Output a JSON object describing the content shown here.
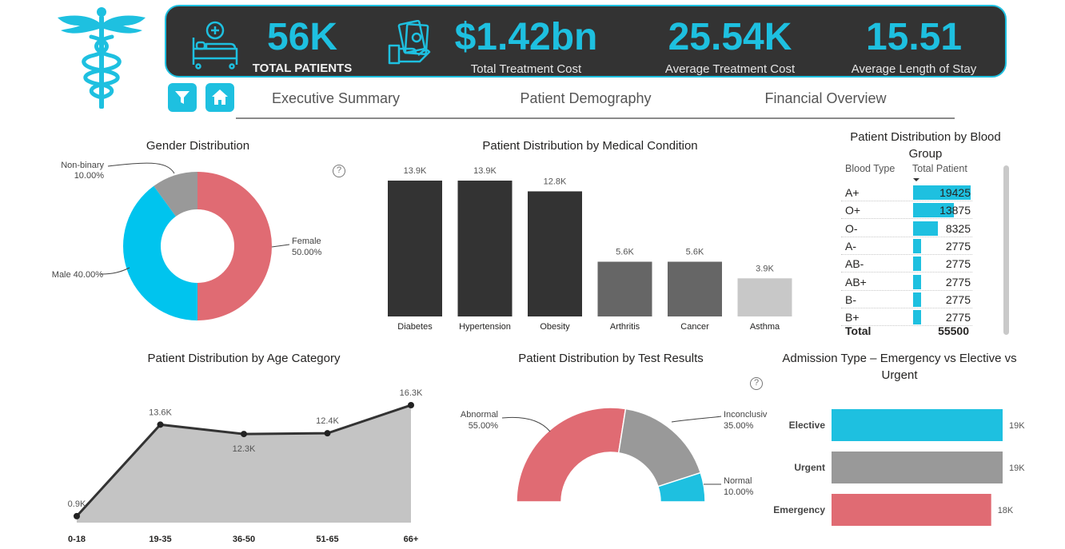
{
  "colors": {
    "accent": "#1ec0e0",
    "dark": "#333333",
    "red": "#e06b73",
    "gray": "#999999",
    "lightgray": "#c8c8c8",
    "midgray": "#666666"
  },
  "logo_icon": "caduceus-icon",
  "kpis": [
    {
      "value": "56K",
      "label": "TOTAL PATIENTS",
      "icon": "hospital-bed-icon"
    },
    {
      "value": "$1.42bn",
      "label": "Total Treatment Cost",
      "icon": "money-hand-icon"
    },
    {
      "value": "25.54K",
      "label": "Average Treatment Cost"
    },
    {
      "value": "15.51",
      "label": "Average Length of Stay"
    }
  ],
  "nav": {
    "filter_icon": "filter-icon",
    "home_icon": "home-icon",
    "tabs": [
      "Executive Summary",
      "Patient Demography",
      "Financial Overview"
    ]
  },
  "chart_data": [
    {
      "id": "gender",
      "type": "pie",
      "title": "Gender Distribution",
      "slices": [
        {
          "label": "Female",
          "value": 50.0,
          "display": "50.00%",
          "color": "#e06b73"
        },
        {
          "label": "Male",
          "value": 40.0,
          "display": "Male 40.00%",
          "color": "#00c4ee"
        },
        {
          "label": "Non-binary",
          "value": 10.0,
          "display": "10.00%",
          "color": "#999999"
        }
      ]
    },
    {
      "id": "condition",
      "type": "bar",
      "title": "Patient Distribution by Medical Condition",
      "categories": [
        "Diabetes",
        "Hypertension",
        "Obesity",
        "Arthritis",
        "Cancer",
        "Asthma"
      ],
      "values": [
        13.9,
        13.9,
        12.8,
        5.6,
        5.6,
        3.9
      ],
      "labels": [
        "13.9K",
        "13.9K",
        "12.8K",
        "5.6K",
        "5.6K",
        "3.9K"
      ],
      "colors": [
        "#333333",
        "#333333",
        "#333333",
        "#666666",
        "#666666",
        "#c8c8c8"
      ],
      "ylim": [
        0,
        13.9
      ]
    },
    {
      "id": "blood",
      "type": "table",
      "title": "Patient Distribution by Blood Group",
      "columns": [
        "Blood Type",
        "Total Patient"
      ],
      "rows": [
        {
          "type": "A+",
          "value": 19425
        },
        {
          "type": "O+",
          "value": 13875
        },
        {
          "type": "O-",
          "value": 8325
        },
        {
          "type": "A-",
          "value": 2775
        },
        {
          "type": "AB-",
          "value": 2775
        },
        {
          "type": "AB+",
          "value": 2775
        },
        {
          "type": "B-",
          "value": 2775
        },
        {
          "type": "B+",
          "value": 2775
        }
      ],
      "total_label": "Total",
      "total_value": "55500"
    },
    {
      "id": "age",
      "type": "area",
      "title": "Patient Distribution by Age Category",
      "categories": [
        "0-18",
        "19-35",
        "36-50",
        "51-65",
        "66+"
      ],
      "values": [
        0.9,
        13.6,
        12.3,
        12.4,
        16.3
      ],
      "labels": [
        "0.9K",
        "13.6K",
        "12.3K",
        "12.4K",
        "16.3K"
      ],
      "ylim": [
        0,
        16.3
      ]
    },
    {
      "id": "tests",
      "type": "pie",
      "title": "Patient Distribution by Test Results",
      "slices": [
        {
          "label": "Abnormal",
          "value": 55.0,
          "display": "55.00%",
          "color": "#e06b73"
        },
        {
          "label": "Inconclusiv",
          "value": 35.0,
          "display": "35.00%",
          "color": "#999999"
        },
        {
          "label": "Normal",
          "value": 10.0,
          "display": "10.00%",
          "color": "#1ec0e0"
        }
      ]
    },
    {
      "id": "admission",
      "type": "bar",
      "title": "Admission Type – Emergency vs Elective vs Urgent",
      "categories": [
        "Elective",
        "Urgent",
        "Emergency"
      ],
      "values": [
        19,
        19,
        18
      ],
      "labels": [
        "19K",
        "19K",
        "18K"
      ],
      "colors": [
        "#1ec0e0",
        "#999999",
        "#e06b73"
      ]
    }
  ]
}
